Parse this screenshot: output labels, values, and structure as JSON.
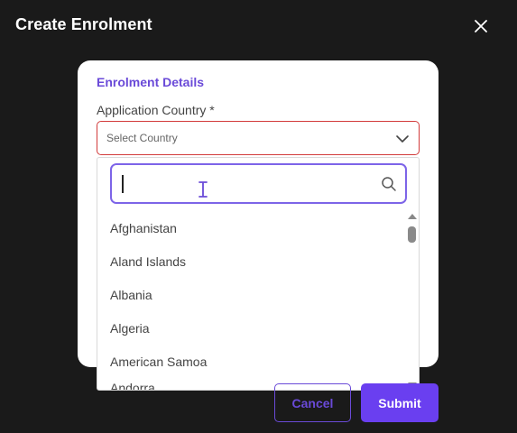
{
  "modal": {
    "title": "Create Enrolment",
    "close_icon": "close-icon"
  },
  "form": {
    "section_title": "Enrolment Details",
    "application_country": {
      "label": "Application Country *",
      "placeholder": "Select Country",
      "state": "error",
      "dropdown_icon": "chevron-down-icon"
    }
  },
  "dropdown": {
    "search": {
      "value": "",
      "placeholder": "",
      "icon": "search-icon"
    },
    "options": [
      "Afghanistan",
      "Aland Islands",
      "Albania",
      "Algeria",
      "American Samoa",
      "Andorra"
    ]
  },
  "actions": {
    "cancel_label": "Cancel",
    "submit_label": "Submit"
  },
  "colors": {
    "background": "#1a1a1a",
    "accent": "#6a3ff0",
    "accent_text": "#6a4ad8",
    "error_border": "#d23b3b",
    "search_focus_border": "#7d64e8"
  }
}
